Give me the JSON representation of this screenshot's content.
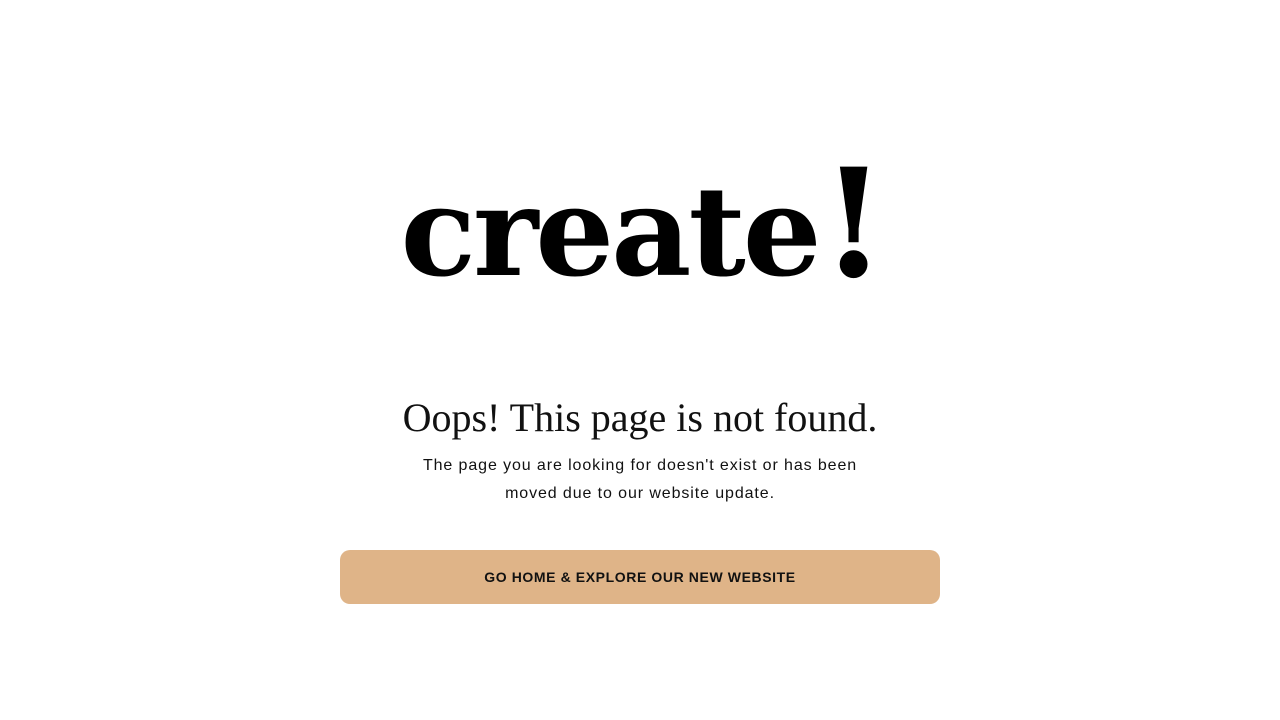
{
  "brand": {
    "logo_word": "create",
    "logo_mark": "!"
  },
  "error": {
    "headline": "Oops! This page is not found.",
    "description_line1": "The page you are looking for doesn't exist or has been",
    "description_line2": "moved due to our website update."
  },
  "cta": {
    "label": "GO HOME & EXPLORE OUR NEW WEBSITE",
    "background_color": "#dfb488"
  },
  "colors": {
    "page_background": "#ffffff",
    "text": "#111111"
  }
}
